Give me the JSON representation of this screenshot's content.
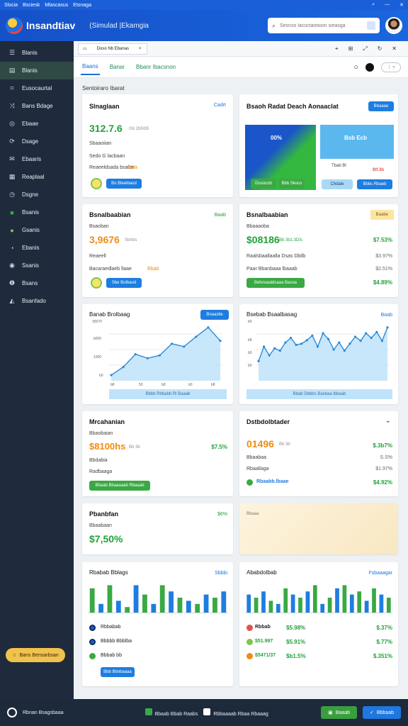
{
  "os_bar": {
    "items": [
      "Slocia",
      "Bsciesk",
      "Mlascasus",
      "Etsnaga"
    ]
  },
  "header": {
    "brand": "Insandtiav",
    "app_title": "(Simulad |Ekamgia",
    "search_placeholder": "Sesrcio lacoctaotioon sieasga"
  },
  "sidebar": {
    "items": [
      {
        "label": "Blanis",
        "icon": "list-icon"
      },
      {
        "label": "Blanis",
        "icon": "table-icon"
      },
      {
        "label": "Eusocaurtal",
        "icon": "chart-icon"
      },
      {
        "label": "Bans Bdage",
        "icon": "shuffle-icon"
      },
      {
        "label": "Ebaae",
        "icon": "target-icon"
      },
      {
        "label": "Dsage",
        "icon": "sync-icon"
      },
      {
        "label": "Ebaaris",
        "icon": "mail-icon"
      },
      {
        "label": "Reaplaal",
        "icon": "calendar-icon"
      },
      {
        "label": "Dsgne",
        "icon": "clock-icon"
      },
      {
        "label": "Bsanis",
        "icon": "folder-icon"
      },
      {
        "label": "Gsanis",
        "icon": "lock-icon"
      },
      {
        "label": "Ebanis",
        "icon": "chat-icon"
      },
      {
        "label": "Ssanis",
        "icon": "globe-icon"
      },
      {
        "label": "Bsans",
        "icon": "info-icon"
      },
      {
        "label": "Bsanfado",
        "icon": "trash-icon"
      }
    ],
    "promo_label": "Bans Bensarbsan"
  },
  "main": {
    "file_tab": {
      "name": "Doso Nb Ebanas",
      "close": "×"
    },
    "tabs": [
      "Baans",
      "Banar",
      "Bbanr Ibacsnon"
    ],
    "section_label": "Sentoiraro Ibarat",
    "cards": {
      "c1": {
        "title": "Slnaglaan",
        "link": "Cadrt",
        "value": "312.7.6",
        "value_sub": "Gb 2b5/b5",
        "line1": "Sbaaoiian",
        "line2": "Sedo G lacbaan",
        "line3": "Reaeeldsada bsalse",
        "line3_accent": "Bbla",
        "button": "Bo Bleeibaod"
      },
      "c2": {
        "title": "Bsaoh Radat Deach Aonaaclat",
        "button": "Bbaaae",
        "tile1": "00%",
        "tile1_btn1": "Dosocob",
        "tile1_btn2": "Bbb Skoos",
        "tile2": "Bsb Ecb",
        "tile2_sub": "Tbab Bl",
        "tile2_btn1": "Chdaie",
        "tile2_btn2": "Bbbs Rbaeb",
        "tile2_accent": "$tf.3b"
      },
      "c3": {
        "title": "Bsnalbaabian",
        "link": "Baab",
        "value": "3,9676",
        "value_sub": "Sbrbts",
        "line1": "Bsaoban",
        "line2": "Reaeell",
        "line3": "Bacaraedlaeb llaae",
        "line3_accent": "Bbab",
        "button": "Sbe Bolbaod"
      },
      "c4": {
        "title": "Bsnalbaabian",
        "badge": "Baabe",
        "sub": "Bbaaaoba",
        "value": "$08186",
        "value_sub": "Bb 3b1.3DIs",
        "value_pct": "$7.53%",
        "row1": "Raalsbaallaalla Dsas Dbilb",
        "row1_pct": "$3.97%",
        "row2": "Paar Bbanbaaa lbaaab",
        "row2_pct": "$2.51%",
        "button": "Bebnsaaldsaaa Basoa",
        "button_pct": "$4.89%"
      },
      "c5": {
        "title": "Banab Brolbaag",
        "button": "Bnaaslte",
        "yticks": [
          "30070",
          "b000",
          "1000",
          "b0"
        ],
        "xticks": [
          "b8",
          "50",
          "b8",
          "b0",
          "b8"
        ],
        "footer": "Bbbb Rbbabb Rl Baaab"
      },
      "c6": {
        "title": "Bsebab Bsaalbasag",
        "link": "Baab",
        "yticks": [
          "b0",
          "b8",
          "b0",
          "b0"
        ],
        "footer": "Bbab Dbbbs Basbaa lbbaab"
      },
      "c7": {
        "title": "Mrcahanian",
        "sub": "Bbaobaian",
        "value": "$8100hs",
        "value_sub": "Bb 3b",
        "value_pct": "$7.5%",
        "line1": "Bbdabia",
        "line2": "Radbaaga",
        "button": "Bbaab Bbaaaaab Rbaaab"
      },
      "c8": {
        "title": "Dstbdolbtader",
        "value": "01496",
        "value_sub": "Bb 3b",
        "value_pct": "$.3b7%",
        "row1": "Bbaabaa",
        "row1_pct": "S.S%",
        "row2": "Rbaallaga",
        "row2_pct": "$1.97%",
        "row3": "Rbaabb.lbaae",
        "row3_pct": "$4.92%"
      },
      "c9": {
        "title": "Pbanbfan",
        "sub": "Bbaabaan",
        "value": "$7,50%",
        "value_pct": "$6%"
      },
      "c10": {
        "label": "Bbaaa"
      },
      "c11": {
        "title": "Rbabab Bblags",
        "link": "Sbbbi",
        "legend": [
          "Rbbabab",
          "Bbbbb Bbblba",
          "Bbbab bb"
        ],
        "button": "Bbb Bbnbaaaa"
      },
      "c12": {
        "title": "Ababdolbab",
        "link": "Fsbaaagar",
        "rows": [
          {
            "label": "Rbbab",
            "mid": "$5.98%",
            "pct": "$.37%"
          },
          {
            "label": "$51.997",
            "mid": "$5.91%",
            "pct": "$.77%"
          },
          {
            "label": "$5471/37",
            "mid": "$b1.5%",
            "pct": "$.351%"
          }
        ]
      }
    }
  },
  "footer": {
    "left": "Rbnan Bsagsbaaa",
    "mid1": "Bbaab Bbab Raabs",
    "mid2": "Rbbaaaab Rbaa Rbaaag",
    "btn1": "Baaab",
    "btn2": "Bbbaab"
  },
  "chart_data": [
    {
      "type": "area",
      "title": "Banab Brolbaag",
      "x": [
        1,
        2,
        3,
        4,
        5,
        6,
        7,
        8,
        9,
        10
      ],
      "values": [
        6,
        20,
        42,
        35,
        40,
        60,
        55,
        72,
        88,
        65
      ],
      "ylim": [
        0,
        100
      ],
      "color": "#2a8bd6"
    },
    {
      "type": "area",
      "title": "Bsebab Bsaalbasag",
      "x": [
        1,
        2,
        3,
        4,
        5,
        6,
        7,
        8,
        9,
        10,
        11,
        12,
        13,
        14,
        15,
        16,
        17,
        18,
        19,
        20,
        21,
        22,
        23,
        24,
        25
      ],
      "values": [
        30,
        55,
        40,
        52,
        48,
        62,
        70,
        58,
        60,
        66,
        74,
        55,
        78,
        68,
        50,
        62,
        48,
        60,
        72,
        65,
        78,
        70,
        80,
        65,
        88
      ],
      "ylim": [
        0,
        100
      ],
      "color": "#2a8bd6"
    },
    {
      "type": "bar",
      "title": "Rbabab Bblags",
      "series": [
        {
          "values": [
            8,
            3,
            9,
            4,
            2,
            9,
            6,
            3,
            9,
            7,
            5,
            4,
            3,
            6,
            5,
            7
          ]
        }
      ],
      "ylim": [
        0,
        10
      ],
      "colors": [
        "#3aa944",
        "#1e7de0"
      ]
    },
    {
      "type": "bar",
      "title": "Ababdolbab",
      "series": [
        {
          "values": [
            6,
            5,
            7,
            4,
            3,
            8,
            6,
            5,
            7,
            9,
            3,
            5,
            8,
            9,
            6,
            7,
            4,
            8,
            6,
            5
          ]
        }
      ],
      "ylim": [
        0,
        10
      ],
      "colors": [
        "#1e7de0",
        "#3aa944"
      ]
    }
  ]
}
